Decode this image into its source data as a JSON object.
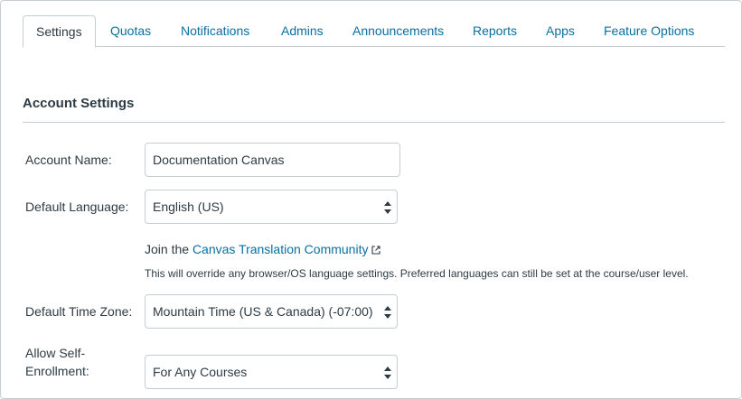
{
  "tabs": [
    {
      "label": "Settings",
      "active": true
    },
    {
      "label": "Quotas"
    },
    {
      "label": "Notifications"
    },
    {
      "label": "Admins"
    },
    {
      "label": "Announcements"
    },
    {
      "label": "Reports"
    },
    {
      "label": "Apps"
    },
    {
      "label": "Feature Options"
    }
  ],
  "section": {
    "title": "Account Settings"
  },
  "form": {
    "account_name": {
      "label": "Account Name:",
      "value": "Documentation Canvas"
    },
    "default_language": {
      "label": "Default Language:",
      "value": "English (US)"
    },
    "join": {
      "prefix": "Join the",
      "link": "Canvas Translation Community"
    },
    "language_help": "This will override any browser/OS language settings. Preferred languages can still be set at the course/user level.",
    "time_zone": {
      "label": "Default Time Zone:",
      "value": "Mountain Time (US & Canada) (-07:00)"
    },
    "self_enrollment": {
      "label_line1": "Allow Self-",
      "label_line2": "Enrollment:",
      "value": "For Any Courses"
    }
  },
  "colors": {
    "link": "#0770a3",
    "text": "#2d3b45",
    "border": "#c7cdd1"
  },
  "icons": {
    "external_link": "external-link-icon",
    "select_arrows": "select-arrows-icon"
  }
}
